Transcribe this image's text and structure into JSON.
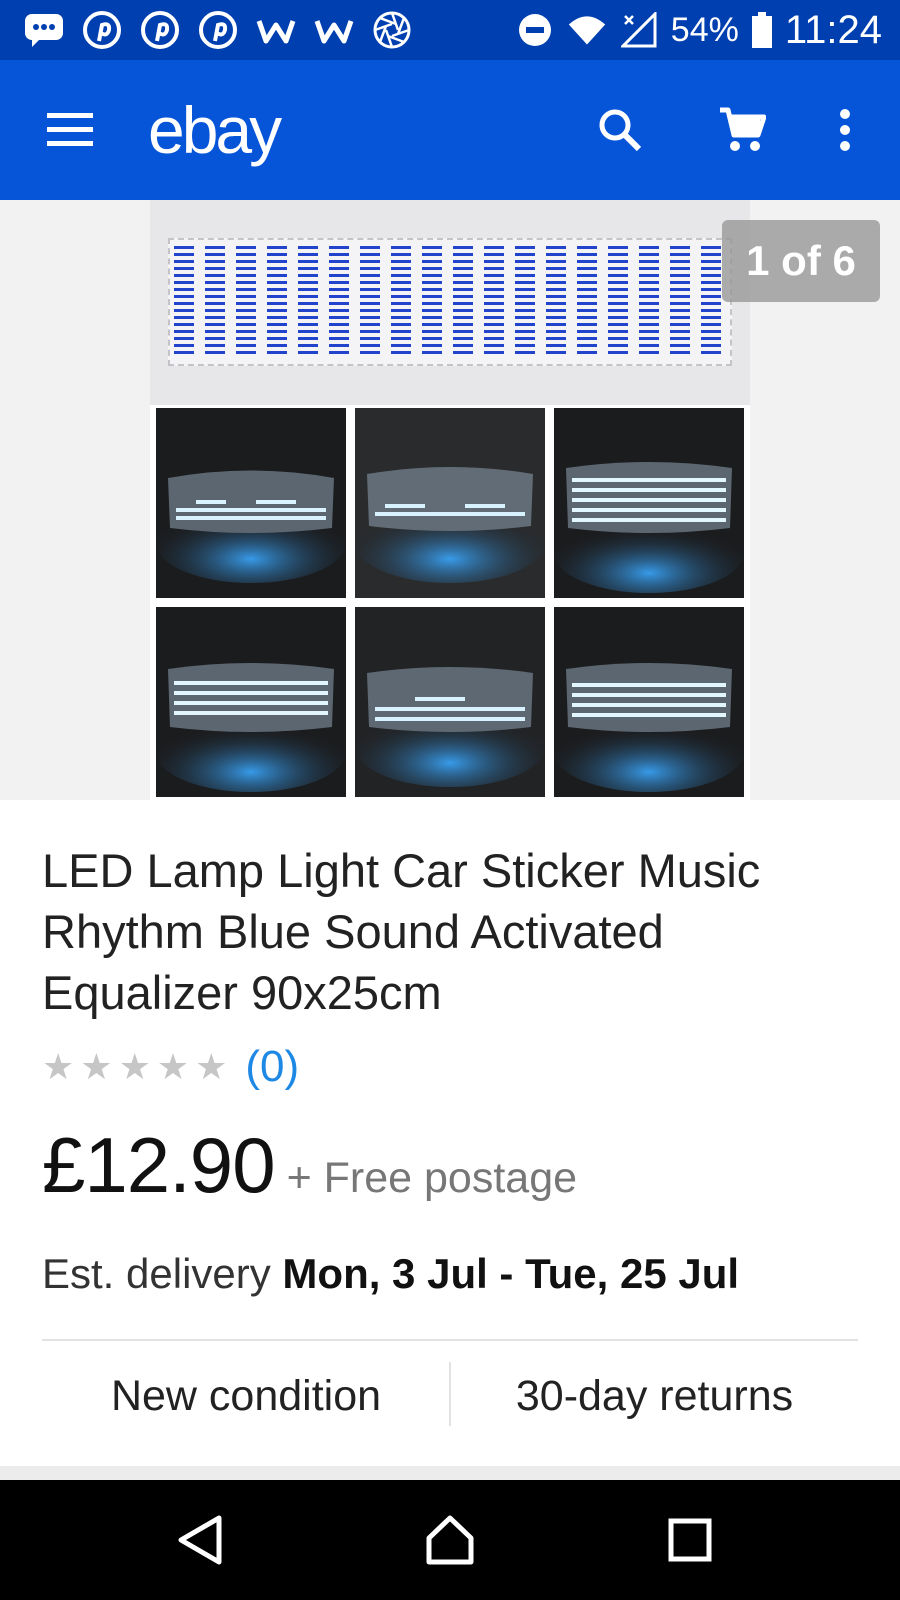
{
  "status_bar": {
    "notification_icons": [
      "chat-bubble-icon",
      "pinterest-icon",
      "pinterest-icon",
      "pinterest-icon",
      "w-app-icon",
      "w-app-icon",
      "aperture-icon"
    ],
    "battery_percent": "54%",
    "time": "11:24"
  },
  "app_bar": {
    "logo": "ebay",
    "icons": [
      "menu-icon",
      "search-icon",
      "cart-icon",
      "more-vert-icon"
    ],
    "color": "#0654d8"
  },
  "gallery": {
    "counter": "1 of 6"
  },
  "product": {
    "title": "LED Lamp Light Car Sticker Music Rhythm Blue Sound Activated Equalizer 90x25cm",
    "rating_stars": 0,
    "rating_count": "(0)",
    "price": "£12.90",
    "postage": "+ Free postage",
    "delivery_label": "Est. delivery",
    "delivery_dates": "Mon, 3 Jul - Tue, 25 Jul",
    "condition": "New condition",
    "returns": "30-day returns"
  },
  "colors": {
    "status_bar": "#003fb0",
    "app_bar": "#0654d8",
    "link": "#1e88e5"
  }
}
